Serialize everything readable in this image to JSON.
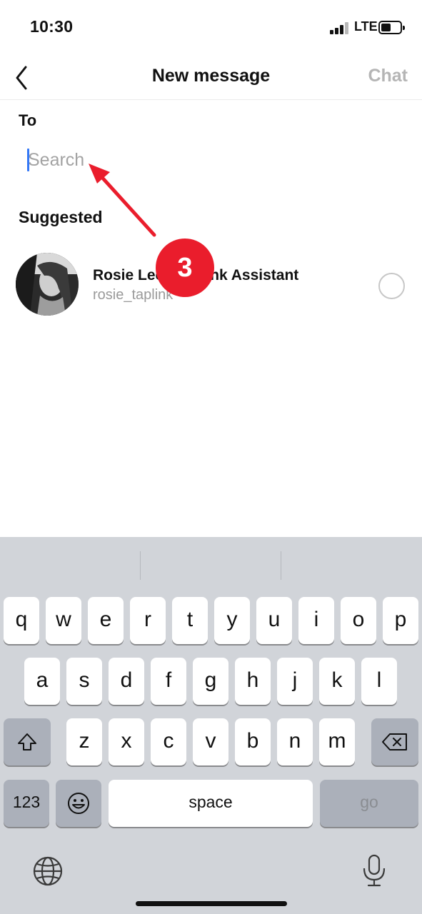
{
  "status_bar": {
    "time": "10:30",
    "network": "LTE",
    "battery_level": 0.5
  },
  "header": {
    "title": "New message",
    "chat_label": "Chat",
    "back_icon": "chevron-left-icon"
  },
  "to": {
    "label": "To",
    "search_placeholder": "Search",
    "search_value": ""
  },
  "suggested": {
    "label": "Suggested",
    "items": [
      {
        "name": "Rosie Lee | Taplink Assistant",
        "username": "rosie_taplink",
        "selected": false
      }
    ]
  },
  "annotation": {
    "step": "3",
    "color": "#ea1d2c"
  },
  "keyboard": {
    "row1": [
      "q",
      "w",
      "e",
      "r",
      "t",
      "y",
      "u",
      "i",
      "o",
      "p"
    ],
    "row2": [
      "a",
      "s",
      "d",
      "f",
      "g",
      "h",
      "j",
      "k",
      "l"
    ],
    "row3": [
      "z",
      "x",
      "c",
      "v",
      "b",
      "n",
      "m"
    ],
    "numbers_key": "123",
    "space_key": "space",
    "go_key": "go",
    "shift_icon": "shift-icon",
    "backspace_icon": "backspace-icon",
    "emoji_icon": "emoji-icon",
    "globe_icon": "globe-icon",
    "mic_icon": "microphone-icon"
  }
}
